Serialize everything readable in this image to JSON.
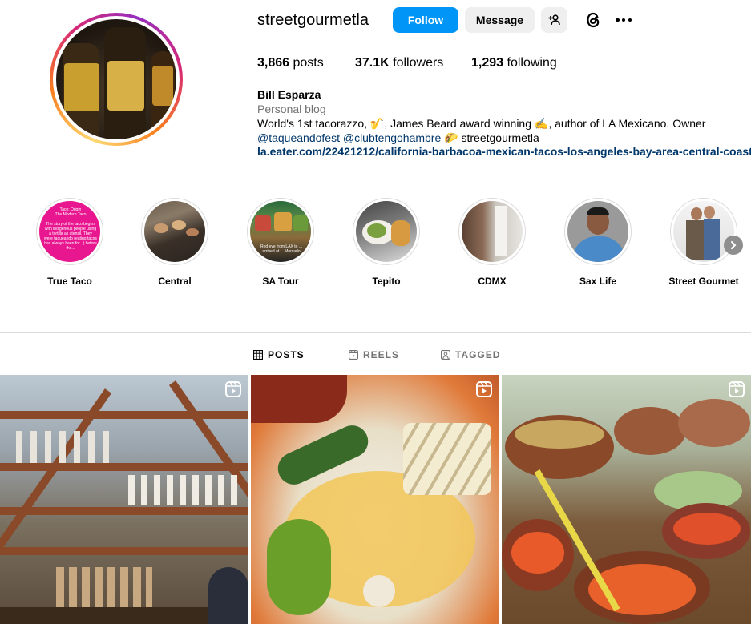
{
  "profile": {
    "username": "streetgourmetla",
    "follow_label": "Follow",
    "message_label": "Message",
    "posts_count": "3,866",
    "posts_label": "posts",
    "followers_count": "37.1K",
    "followers_label": "followers",
    "following_count": "1,293",
    "following_label": "following",
    "full_name": "Bill Esparza",
    "category": "Personal blog",
    "bio_line1_a": "World's 1st tacorazzo, ",
    "bio_emoji1": "🎷",
    "bio_line1_b": ", James Beard award winning ",
    "bio_emoji2": "✍️",
    "bio_line1_c": ", author of LA Mexicano. Owner",
    "mention1": "@taqueandofest",
    "mention2": "@clubtengohambre",
    "bio_emoji3": "🌮",
    "bio_line2_tail": "streetgourmetla",
    "link": "la.eater.com/22421212/california-barbacoa-mexican-tacos-los-angeles-bay-area-central-coast"
  },
  "highlights": [
    {
      "label": "True Taco",
      "preview_text": "Taco: Origin\nThe Modern Taco\n\nThe story of the taco begins with indigenous people using a tortilla as utensil. They were taqueando (eating tacos has always been for...) before the..."
    },
    {
      "label": "Central"
    },
    {
      "label": "SA Tour",
      "preview_text": "Red eye from LAX to ... arrived at ... Mercado"
    },
    {
      "label": "Tepito"
    },
    {
      "label": "CDMX"
    },
    {
      "label": "Sax Life"
    },
    {
      "label": "Street Gourmet"
    }
  ],
  "tabs": [
    {
      "label": "POSTS",
      "icon": "grid-icon",
      "active": true
    },
    {
      "label": "REELS",
      "icon": "reels-icon",
      "active": false
    },
    {
      "label": "TAGGED",
      "icon": "tagged-icon",
      "active": false
    }
  ],
  "colors": {
    "follow_button": "#0095f6",
    "secondary_button": "#efefef",
    "link": "#00376b",
    "muted": "#737373"
  },
  "icons": {
    "suggest": "person-add-icon",
    "threads": "threads-icon",
    "more": "more-options-icon",
    "next": "chevron-right-icon",
    "reel": "reel-badge-icon"
  }
}
